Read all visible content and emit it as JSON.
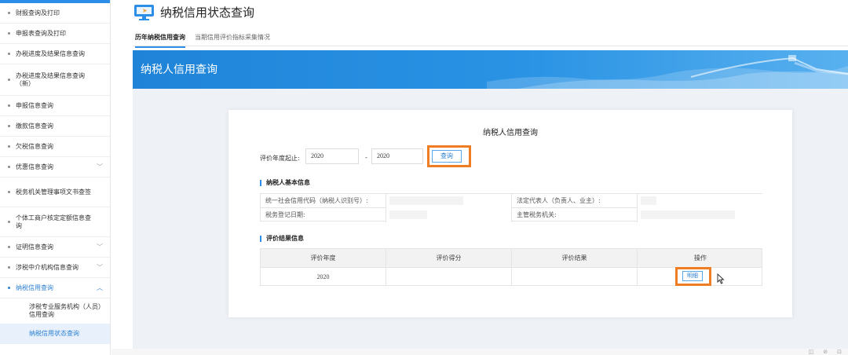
{
  "sidebar": {
    "items": [
      {
        "label": "财报查询及打印",
        "chevron": ""
      },
      {
        "label": "申报表查询及打印",
        "chevron": ""
      },
      {
        "label": "办税进度及结果信息查询",
        "chevron": ""
      },
      {
        "label": "办税进度及结果信息查询（新）",
        "chevron": ""
      },
      {
        "label": "申报信息查询",
        "chevron": ""
      },
      {
        "label": "缴款信息查询",
        "chevron": ""
      },
      {
        "label": "欠税信息查询",
        "chevron": ""
      },
      {
        "label": "优惠信息查询",
        "chevron": "﹀"
      },
      {
        "label": "税务机关管理事项文书查签",
        "chevron": ""
      },
      {
        "label": "个体工商户核定定额信息查询",
        "chevron": ""
      },
      {
        "label": "证明信息查询",
        "chevron": "﹀"
      },
      {
        "label": "涉税中介机构信息查询",
        "chevron": "﹀"
      },
      {
        "label": "纳税信用查询",
        "chevron": "︿"
      }
    ],
    "sub_items": [
      {
        "label": "涉税专业服务机构（人员）信用查询"
      },
      {
        "label": "纳税信用状态查询"
      }
    ]
  },
  "header": {
    "title": "纳税信用状态查询",
    "tabs": [
      {
        "label": "历年纳税信用查询"
      },
      {
        "label": "当期信用评价指标采集情况"
      }
    ]
  },
  "banner": {
    "title": "纳税人信用查询"
  },
  "card": {
    "title": "纳税人信用查询",
    "filter_label": "评价年度起止:",
    "year_from": "2020",
    "range_sep": "-",
    "year_to": "2020",
    "query_button": "查询",
    "basic_info_title": "纳税人基本信息",
    "basic_info": {
      "credit_code_label": "统一社会信用代码（纳税人识别号）:",
      "legal_rep_label": "法定代表人（负责人、业主）:",
      "reg_date_label": "税务登记日期:",
      "tax_authority_label": "主管税务机关:"
    },
    "result_title": "评价结果信息",
    "result_table": {
      "headers": [
        "评价年度",
        "评价得分",
        "评价结果",
        "操作"
      ],
      "rows": [
        {
          "year": "2020",
          "score": "",
          "result": "",
          "action": "明细"
        }
      ]
    }
  },
  "status_icons": [
    "◫",
    "⊘",
    "⊡"
  ],
  "colors": {
    "accent": "#2c8ee6",
    "highlight": "#ee7d24",
    "link": "#2a7fd4"
  }
}
